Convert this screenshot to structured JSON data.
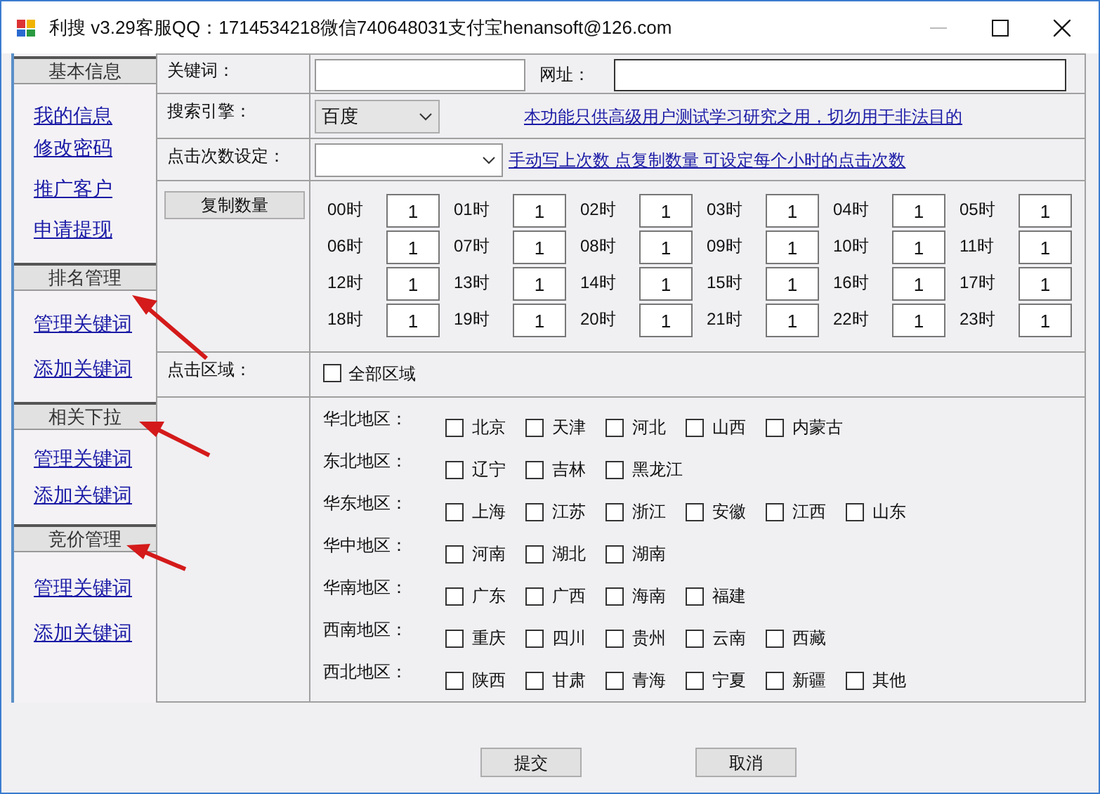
{
  "window": {
    "title": "利搜 v3.29客服QQ：1714534218微信740648031支付宝henansoft@126.com"
  },
  "sidebar": {
    "sections": [
      {
        "header": "基本信息",
        "links": [
          "我的信息",
          "修改密码",
          "推广客户",
          "申请提现"
        ]
      },
      {
        "header": "排名管理",
        "links": [
          "管理关键词",
          "添加关键词"
        ]
      },
      {
        "header": "相关下拉",
        "links": [
          "管理关键词",
          "添加关键词"
        ]
      },
      {
        "header": "竞价管理",
        "links": [
          "管理关键词",
          "添加关键词"
        ]
      }
    ]
  },
  "form": {
    "keyword": {
      "label": "关键词："
    },
    "url": {
      "label": "网址："
    },
    "engine": {
      "label": "搜索引擎：",
      "value": "百度"
    },
    "notice_link": "本功能只供高级用户测试学习研究之用，切勿用于非法目的",
    "click_count": {
      "label": "点击次数设定："
    },
    "hint_link": "手动写上次数 点复制数量 可设定每个小时的点击次数",
    "copy_button": "复制数量",
    "hours": [
      {
        "label": "00时",
        "value": "1"
      },
      {
        "label": "01时",
        "value": "1"
      },
      {
        "label": "02时",
        "value": "1"
      },
      {
        "label": "03时",
        "value": "1"
      },
      {
        "label": "04时",
        "value": "1"
      },
      {
        "label": "05时",
        "value": "1"
      },
      {
        "label": "06时",
        "value": "1"
      },
      {
        "label": "07时",
        "value": "1"
      },
      {
        "label": "08时",
        "value": "1"
      },
      {
        "label": "09时",
        "value": "1"
      },
      {
        "label": "10时",
        "value": "1"
      },
      {
        "label": "11时",
        "value": "1"
      },
      {
        "label": "12时",
        "value": "1"
      },
      {
        "label": "13时",
        "value": "1"
      },
      {
        "label": "14时",
        "value": "1"
      },
      {
        "label": "15时",
        "value": "1"
      },
      {
        "label": "16时",
        "value": "1"
      },
      {
        "label": "17时",
        "value": "1"
      },
      {
        "label": "18时",
        "value": "1"
      },
      {
        "label": "19时",
        "value": "1"
      },
      {
        "label": "20时",
        "value": "1"
      },
      {
        "label": "21时",
        "value": "1"
      },
      {
        "label": "22时",
        "value": "1"
      },
      {
        "label": "23时",
        "value": "1"
      }
    ],
    "click_area": {
      "label": "点击区域：",
      "all": {
        "label": "全部区域",
        "checked": false
      }
    },
    "regions": [
      {
        "label": "华北地区：",
        "provinces": [
          {
            "name": "北京",
            "checked": false
          },
          {
            "name": "天津",
            "checked": false
          },
          {
            "name": "河北",
            "checked": false
          },
          {
            "name": "山西",
            "checked": false
          },
          {
            "name": "内蒙古",
            "checked": false
          }
        ]
      },
      {
        "label": "东北地区：",
        "provinces": [
          {
            "name": "辽宁",
            "checked": false
          },
          {
            "name": "吉林",
            "checked": false
          },
          {
            "name": "黑龙江",
            "checked": false
          }
        ]
      },
      {
        "label": "华东地区：",
        "provinces": [
          {
            "name": "上海",
            "checked": false
          },
          {
            "name": "江苏",
            "checked": false
          },
          {
            "name": "浙江",
            "checked": false
          },
          {
            "name": "安徽",
            "checked": false
          },
          {
            "name": "江西",
            "checked": false
          },
          {
            "name": "山东",
            "checked": false
          }
        ]
      },
      {
        "label": "华中地区：",
        "provinces": [
          {
            "name": "河南",
            "checked": false
          },
          {
            "name": "湖北",
            "checked": false
          },
          {
            "name": "湖南",
            "checked": false
          }
        ]
      },
      {
        "label": "华南地区：",
        "provinces": [
          {
            "name": "广东",
            "checked": false
          },
          {
            "name": "广西",
            "checked": false
          },
          {
            "name": "海南",
            "checked": false
          },
          {
            "name": "福建",
            "checked": false
          }
        ]
      },
      {
        "label": "西南地区：",
        "provinces": [
          {
            "name": "重庆",
            "checked": false
          },
          {
            "name": "四川",
            "checked": false
          },
          {
            "name": "贵州",
            "checked": false
          },
          {
            "name": "云南",
            "checked": false
          },
          {
            "name": "西藏",
            "checked": false
          }
        ]
      },
      {
        "label": "西北地区：",
        "provinces": [
          {
            "name": "陕西",
            "checked": false
          },
          {
            "name": "甘肃",
            "checked": false
          },
          {
            "name": "青海",
            "checked": false
          },
          {
            "name": "宁夏",
            "checked": false
          },
          {
            "name": "新疆",
            "checked": false
          },
          {
            "name": "其他",
            "checked": false
          }
        ]
      }
    ]
  },
  "buttons": [
    "提交",
    "取消"
  ]
}
